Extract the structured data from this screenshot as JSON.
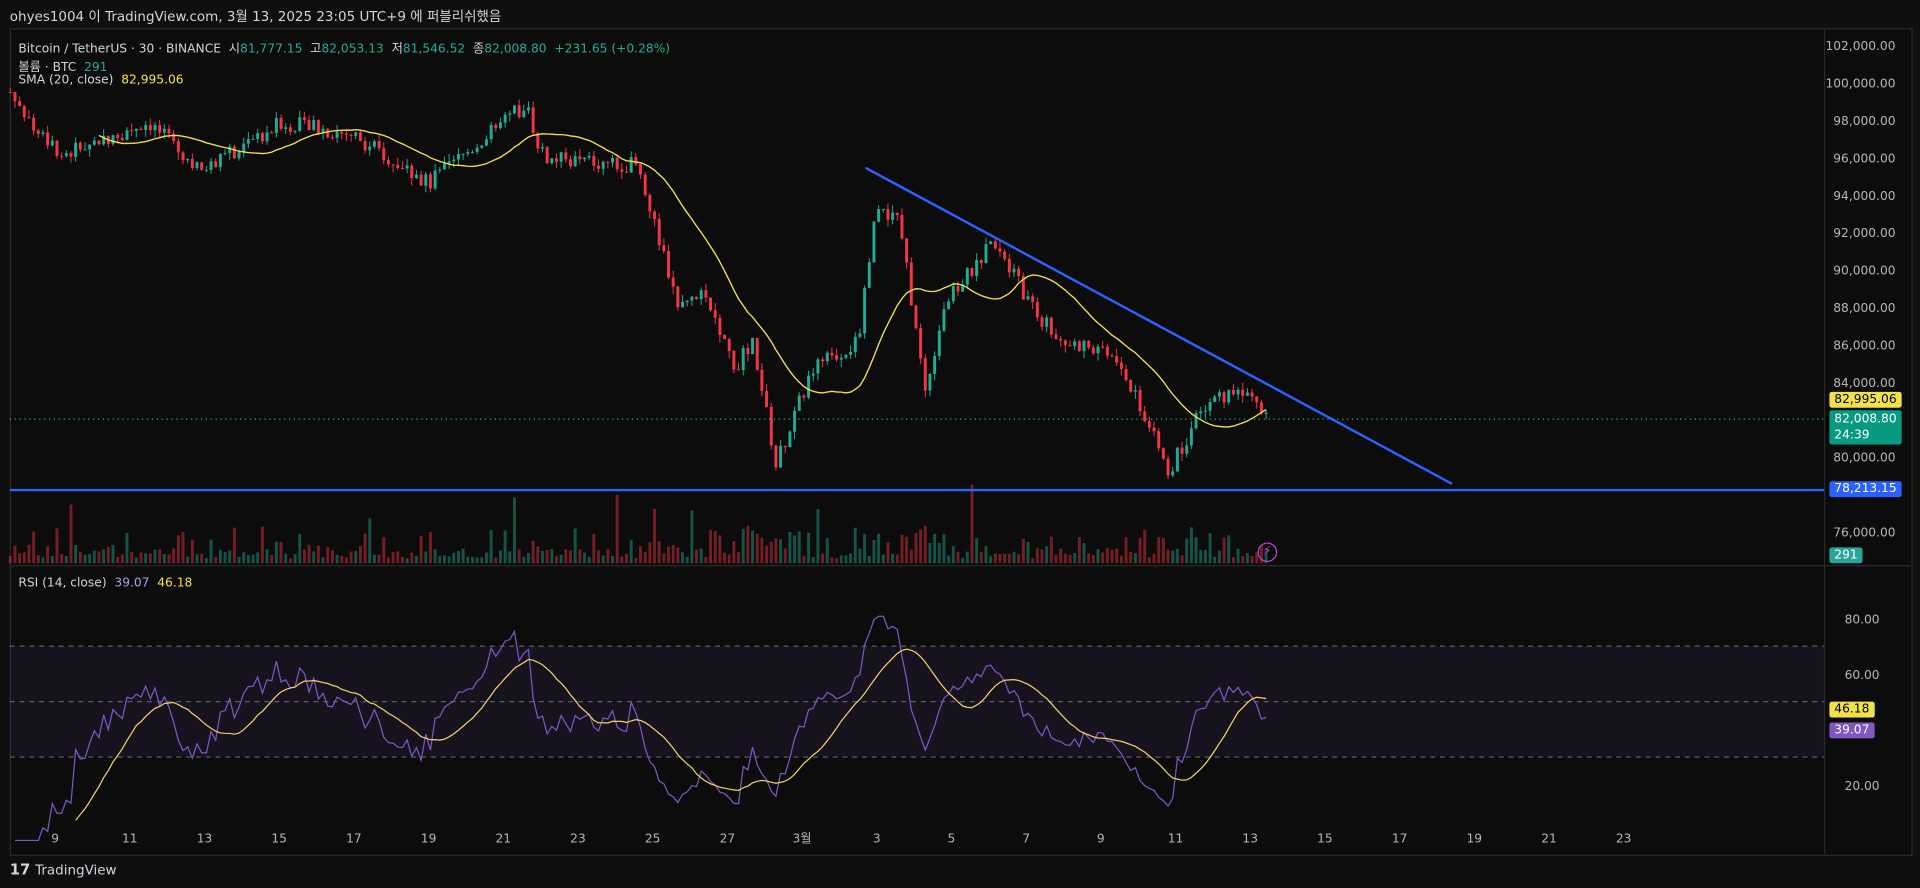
{
  "header": {
    "published": "ohyes1004 이 TradingView.com, 3월 13, 2025 23:05 UTC+9 에 퍼블리쉬했음"
  },
  "legend": {
    "symbol": "Bitcoin / TetherUS · 30 · BINANCE",
    "o_label": "시",
    "o": "81,777.15",
    "h_label": "고",
    "h": "82,053.13",
    "l_label": "저",
    "l": "81,546.52",
    "c_label": "종",
    "c": "82,008.80",
    "change": "+231.65 (+0.28%)",
    "volume_label": "볼륨 · BTC",
    "volume": "291",
    "sma_label": "SMA (20, close)",
    "sma": "82,995.06",
    "rsi_label": "RSI (14, close)",
    "rsi": "39.07",
    "rsi_ma": "46.18"
  },
  "price_labels": {
    "sma": "82,995.06",
    "last": "82,008.80",
    "countdown": "24:39",
    "hline": "78,213.15",
    "volume": "291",
    "rsi_ma": "46.18",
    "rsi": "39.07"
  },
  "footer": {
    "brand": "TradingView"
  },
  "colors": {
    "up": "#22ab94",
    "down": "#f23645",
    "sma": "#f2e24a",
    "trend": "#2962ff",
    "rsi": "#7e57c2",
    "rsi_ma": "#f2d16b"
  },
  "chart_data": {
    "type": "candlestick",
    "price_axis": {
      "ticks": [
        102000,
        100000,
        98000,
        96000,
        94000,
        92000,
        90000,
        88000,
        86000,
        84000,
        80000,
        76000
      ],
      "tick_labels": [
        "102,000.00",
        "100,000.00",
        "98,000.00",
        "96,000.00",
        "94,000.00",
        "92,000.00",
        "90,000.00",
        "88,000.00",
        "86,000.00",
        "84,000.00",
        "80,000.00",
        "76,000.00"
      ],
      "range": [
        75000,
        103000
      ]
    },
    "rsi_axis": {
      "ticks": [
        80,
        60,
        20
      ],
      "tick_labels": [
        "80.00",
        "60.00",
        "20.00"
      ],
      "bands": [
        30,
        50,
        70
      ],
      "range": [
        10,
        92
      ]
    },
    "time_axis": {
      "labels": [
        "9",
        "11",
        "13",
        "15",
        "17",
        "19",
        "21",
        "23",
        "25",
        "27",
        "3월",
        "3",
        "5",
        "7",
        "9",
        "11",
        "13",
        "15",
        "17",
        "19",
        "21",
        "23"
      ],
      "unit": "day index from Feb 8, step 2"
    },
    "price_path": [
      [
        -0.2,
        99500
      ],
      [
        0.2,
        97900
      ],
      [
        1.2,
        96200
      ],
      [
        3.5,
        97900
      ],
      [
        4.9,
        95250
      ],
      [
        7.1,
        97900
      ],
      [
        9.0,
        97200
      ],
      [
        11.0,
        94600
      ],
      [
        13.6,
        98850
      ],
      [
        14.1,
        95900
      ],
      [
        16.6,
        95600
      ],
      [
        17.7,
        88050
      ],
      [
        18.4,
        88700
      ],
      [
        19.2,
        84800
      ],
      [
        19.7,
        86100
      ],
      [
        20.3,
        79550
      ],
      [
        21.3,
        84800
      ],
      [
        22.5,
        86100
      ],
      [
        23.0,
        93300
      ],
      [
        23.6,
        92600
      ],
      [
        24.3,
        83500
      ],
      [
        24.8,
        88050
      ],
      [
        26.2,
        91650
      ],
      [
        27.1,
        88050
      ],
      [
        28.0,
        86100
      ],
      [
        29.2,
        85750
      ],
      [
        30.3,
        81850
      ],
      [
        30.8,
        79200
      ],
      [
        31.8,
        82800
      ],
      [
        33.0,
        83800
      ],
      [
        33.5,
        82008.8
      ]
    ],
    "trendline": [
      [
        22.7,
        95450
      ],
      [
        38.4,
        78550
      ]
    ],
    "horizontal_line": 78213.15,
    "sma_period": 20,
    "rsi_period": 14
  }
}
